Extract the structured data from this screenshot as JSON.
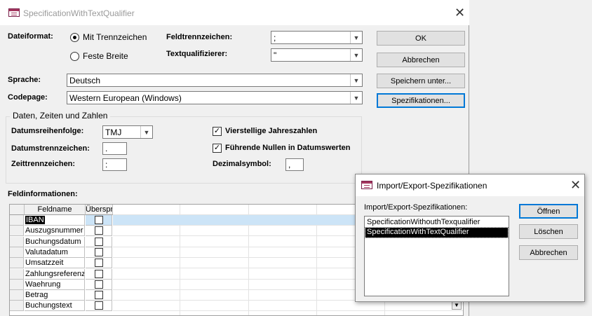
{
  "main": {
    "title": "SpecificationWithTextQualifier",
    "dateiformat_label": "Dateiformat:",
    "radio_delimited": "Mit Trennzeichen",
    "radio_fixed": "Feste Breite",
    "feldtrennzeichen_label": "Feldtrennzeichen:",
    "feldtrennzeichen_value": ";",
    "textqualifizierer_label": "Textqualifizierer:",
    "textqualifizierer_value": "\"",
    "sprache_label": "Sprache:",
    "sprache_value": "Deutsch",
    "codepage_label": "Codepage:",
    "codepage_value": "Western European (Windows)",
    "buttons": {
      "ok": "OK",
      "cancel": "Abbrechen",
      "save_as": "Speichern unter...",
      "specs": "Spezifikationen..."
    },
    "group_title": "Daten, Zeiten und Zahlen",
    "datumsreihenfolge_label": "Datumsreihenfolge:",
    "datumsreihenfolge_value": "TMJ",
    "datumstrennzeichen_label": "Datumstrennzeichen:",
    "datumstrennzeichen_value": ".",
    "zeittrennzeichen_label": "Zeittrennzeichen:",
    "zeittrennzeichen_value": ":",
    "four_digit_years_label": "Vierstellige Jahreszahlen",
    "leading_zeros_label": "Führende Nullen in Datumswerten",
    "dezimalsymbol_label": "Dezimalsymbol:",
    "dezimalsymbol_value": ",",
    "feldinformationen_label": "Feldinformationen:",
    "grid_headers": [
      "Feldname",
      "Überspr"
    ],
    "fields": [
      "IBAN",
      "Auszugsnummer",
      "Buchungsdatum",
      "Valutadatum",
      "Umsatzzeit",
      "Zahlungsreferenz",
      "Waehrung",
      "Betrag",
      "Buchungstext"
    ]
  },
  "popup": {
    "title": "Import/Export-Spezifikationen",
    "list_label": "Import/Export-Spezifikationen:",
    "items": [
      "SpecificationWithouthTexqualifier",
      "SpecificationWithTextQualifier"
    ],
    "buttons": {
      "open": "Öffnen",
      "delete": "Löschen",
      "cancel": "Abbrechen"
    }
  },
  "icons": {
    "dialog": "table-form-icon",
    "close": "close-icon",
    "dropdown": "chevron-down-icon",
    "checked": "checkmark-icon"
  },
  "colors": {
    "focus_border": "#0078d7",
    "row_highlight": "#cce4f7",
    "selection": "#000000"
  }
}
